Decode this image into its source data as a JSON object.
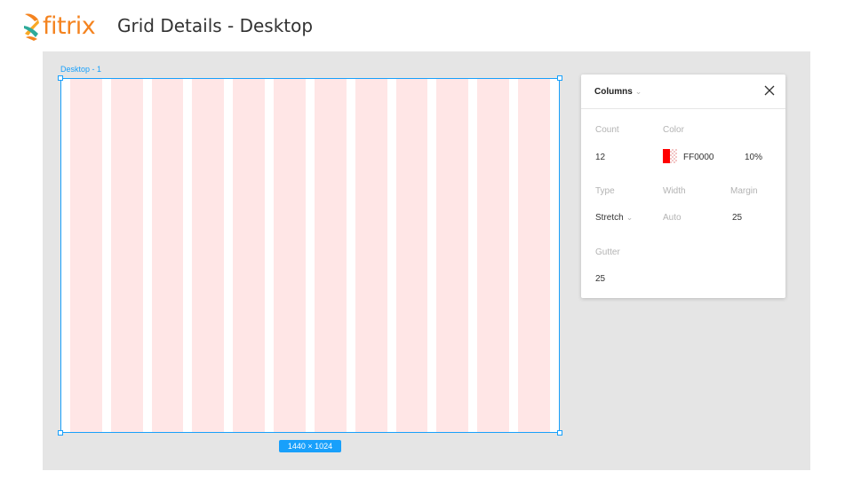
{
  "header": {
    "logo_text": "fitrix",
    "title": "Grid Details - Desktop"
  },
  "canvas": {
    "frame_label": "Desktop - 1",
    "frame_size": "1440 × 1024",
    "grid_color": "#ffe6e6",
    "selection_color": "#18a0fb"
  },
  "panel": {
    "title": "Columns",
    "count_label": "Count",
    "count_value": "12",
    "color_label": "Color",
    "color_hex": "FF0000",
    "color_opacity": "10%",
    "type_label": "Type",
    "type_value": "Stretch",
    "width_label": "Width",
    "width_value": "Auto",
    "margin_label": "Margin",
    "margin_value": "25",
    "gutter_label": "Gutter",
    "gutter_value": "25",
    "icons": [
      "chevron-down-icon",
      "close-icon",
      "color-swatch"
    ]
  }
}
